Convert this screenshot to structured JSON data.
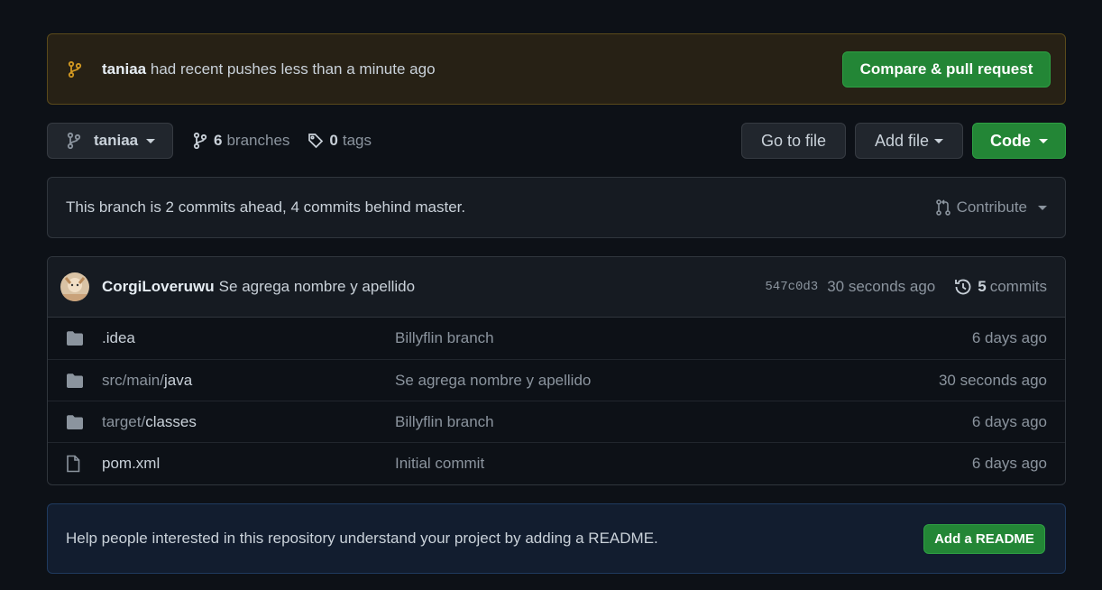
{
  "flash": {
    "user": "taniaa",
    "message": "had recent pushes less than a minute ago",
    "button": "Compare & pull request"
  },
  "nav": {
    "branch": "taniaa",
    "branches_count": "6",
    "branches_label": "branches",
    "tags_count": "0",
    "tags_label": "tags",
    "goto_file": "Go to file",
    "add_file": "Add file",
    "code": "Code"
  },
  "ahead_behind": {
    "text": "This branch is 2 commits ahead, 4 commits behind master.",
    "contribute": "Contribute"
  },
  "latest_commit": {
    "author": "CorgiLoveruwu",
    "message": "Se agrega nombre y apellido",
    "sha": "547c0d3",
    "time": "30 seconds ago",
    "commit_count": "5",
    "commit_label": "commits"
  },
  "files": [
    {
      "prefix": "",
      "name": ".idea",
      "type": "folder",
      "message": "Billyflin branch",
      "age": "6 days ago"
    },
    {
      "prefix": "src/main/",
      "name": "java",
      "type": "folder",
      "message": "Se agrega nombre y apellido",
      "age": "30 seconds ago"
    },
    {
      "prefix": "target/",
      "name": "classes",
      "type": "folder",
      "message": "Billyflin branch",
      "age": "6 days ago"
    },
    {
      "prefix": "",
      "name": "pom.xml",
      "type": "file",
      "message": "Initial commit",
      "age": "6 days ago"
    }
  ],
  "readme": {
    "text": "Help people interested in this repository understand your project by adding a README.",
    "button": "Add a README"
  },
  "colors": {
    "background": "#0d1117",
    "primary_green": "#238636",
    "flash_bg": "#272115",
    "readme_bg": "#121d2f"
  }
}
